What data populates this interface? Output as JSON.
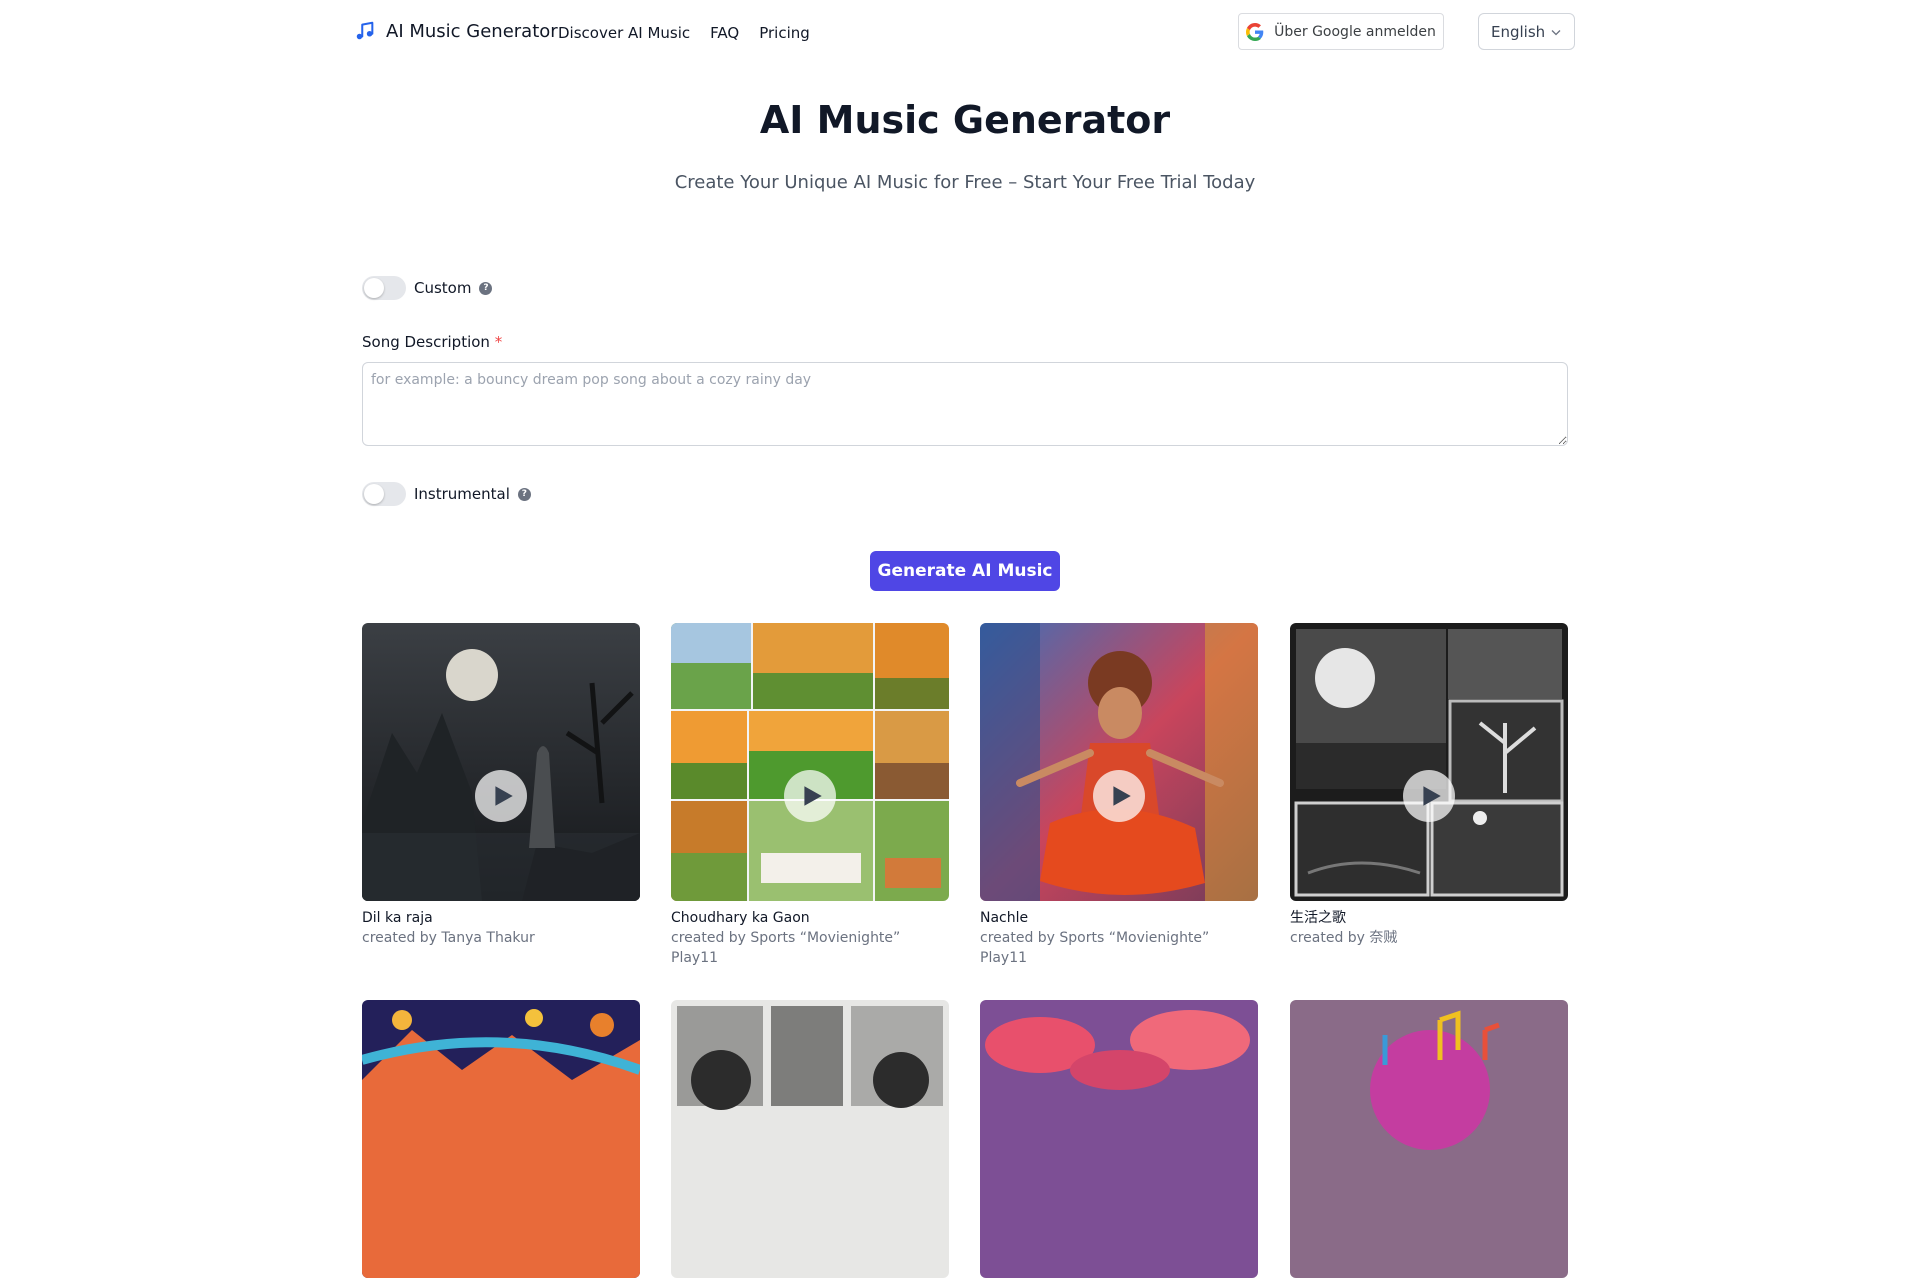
{
  "header": {
    "brand": "AI Music Generator",
    "nav": [
      "Discover AI Music",
      "FAQ",
      "Pricing"
    ],
    "google_button": "Über Google anmelden",
    "language": "English"
  },
  "hero": {
    "title": "AI Music Generator",
    "subtitle": "Create Your Unique AI Music for Free – Start Your Free Trial Today"
  },
  "form": {
    "custom_label": "Custom",
    "custom_on": false,
    "description_label": "Song Description",
    "description_required": "*",
    "description_placeholder": "for example: a bouncy dream pop song about a cozy rainy day",
    "description_value": "",
    "instrumental_label": "Instrumental",
    "instrumental_on": false,
    "generate_label": "Generate AI Music"
  },
  "songs": [
    {
      "title": "Dil ka raja",
      "creator": "created by Tanya Thakur"
    },
    {
      "title": "Choudhary ka Gaon",
      "creator": "created by Sports “Movienighte” Play11"
    },
    {
      "title": "Nachle",
      "creator": "created by Sports “Movienighte” Play11"
    },
    {
      "title": "生活之歌",
      "creator": "created by 奈贼"
    }
  ],
  "colors": {
    "accent": "#4f46e5",
    "required": "#ef4444",
    "muted_text": "#6b7280"
  },
  "icons": {
    "brand": "music-note-icon",
    "google": "google-g-icon",
    "language": "chevron-down-icon",
    "help": "question-circle-icon",
    "play": "play-icon"
  }
}
